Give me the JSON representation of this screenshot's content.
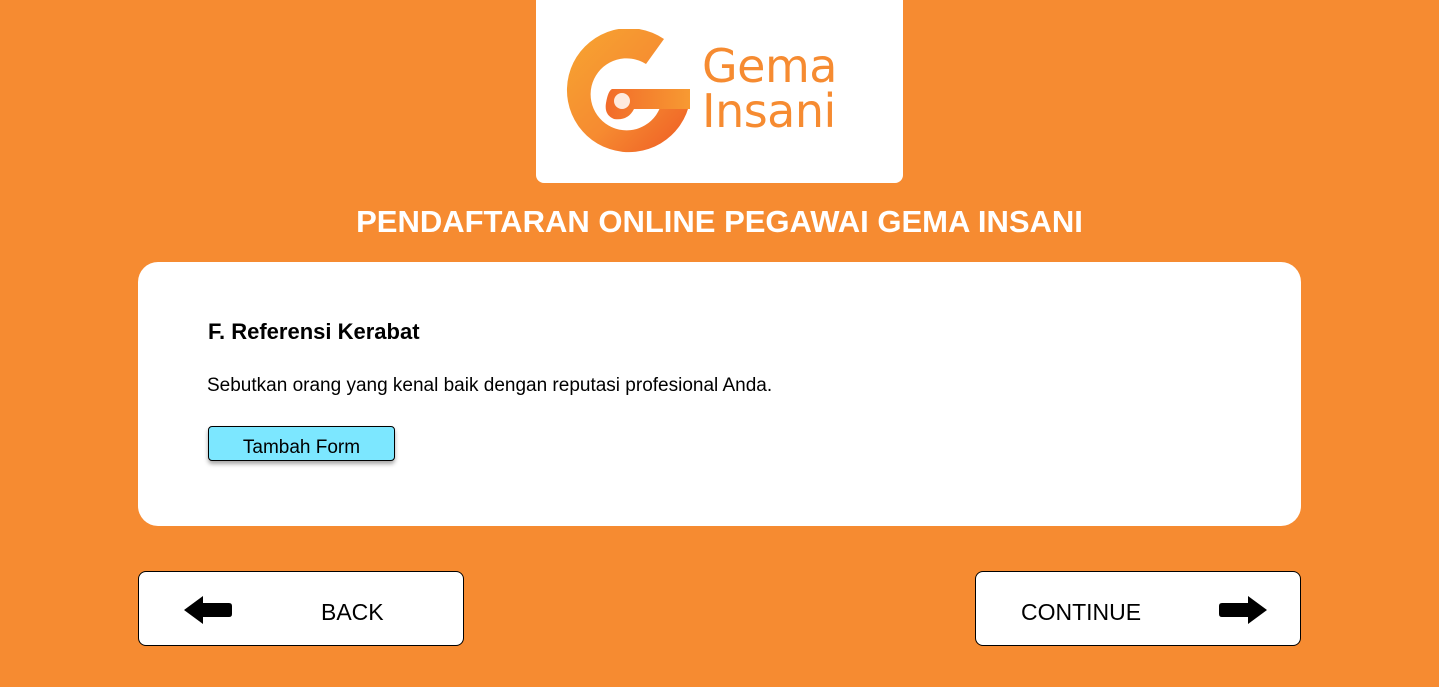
{
  "brand": {
    "logo_line1": "Gema",
    "logo_line2": "Insani",
    "color_primary": "#F68B31",
    "icon": "gema-insani-logo-mark"
  },
  "header": {
    "title": "PENDAFTARAN ONLINE PEGAWAI GEMA INSANI"
  },
  "section": {
    "title": "F. Referensi Kerabat",
    "description": "Sebutkan orang yang kenal baik dengan reputasi profesional Anda.",
    "add_button_label": "Tambah Form",
    "add_button_color": "#7CE7FF"
  },
  "nav": {
    "back_label": "BACK",
    "back_icon": "arrow-left-icon",
    "continue_label": "CONTINUE",
    "continue_icon": "arrow-right-icon"
  }
}
